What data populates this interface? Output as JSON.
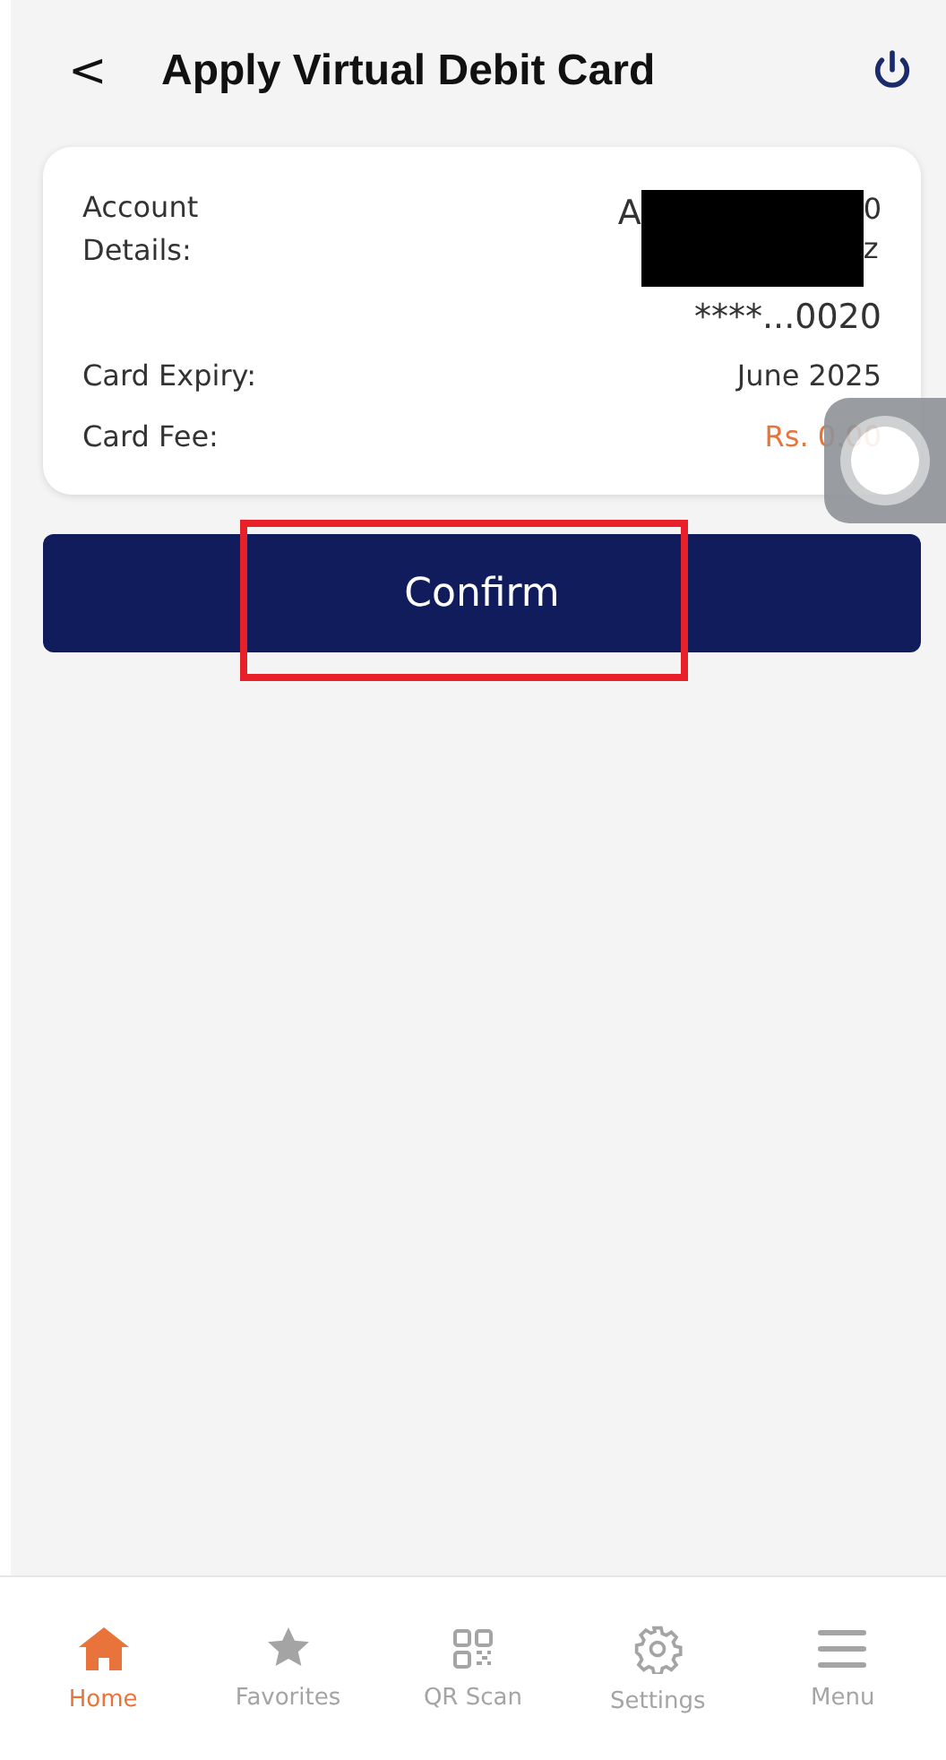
{
  "header": {
    "back": "<",
    "title": "Apply Virtual Debit Card"
  },
  "details": {
    "account_label": "Account Details:",
    "account_line_1_start": "A",
    "account_line_1_end": "0",
    "account_line_2_end": "z",
    "account_number": "****...0020",
    "rows": [
      {
        "label": "Card Expiry:",
        "value": "June 2025",
        "kind": "plain"
      },
      {
        "label": "Card Fee:",
        "value": "Rs. 0.00",
        "kind": "fee"
      }
    ]
  },
  "confirm_button": "Confirm",
  "nav": [
    {
      "label": "Home",
      "kind": "home",
      "selected": true
    },
    {
      "label": "Favorites",
      "kind": "star",
      "selected": false
    },
    {
      "label": "QR Scan",
      "kind": "qr",
      "selected": false
    },
    {
      "label": "Settings",
      "kind": "gear",
      "selected": false
    },
    {
      "label": "Menu",
      "kind": "menu",
      "selected": false
    }
  ]
}
